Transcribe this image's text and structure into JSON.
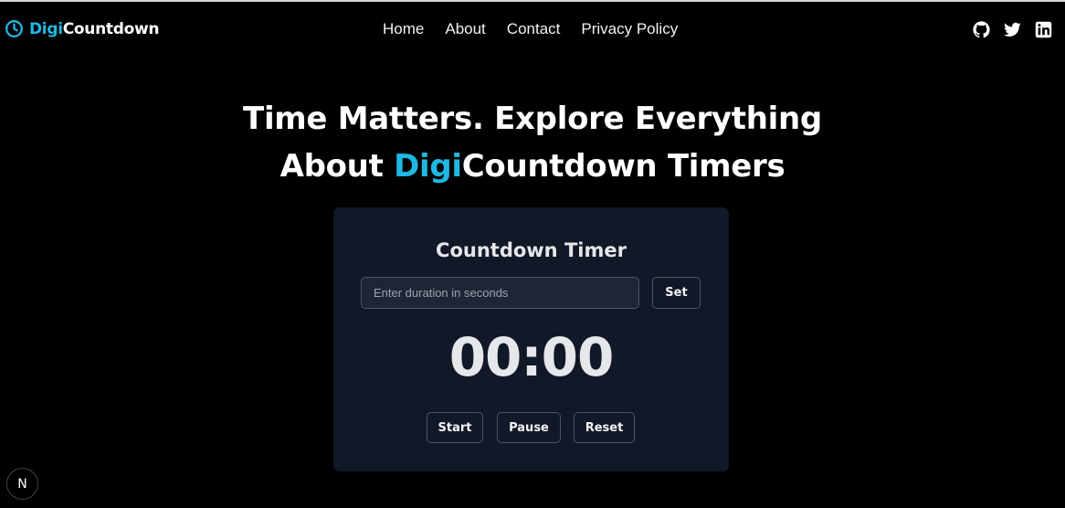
{
  "brand": {
    "prefix": "Digi",
    "suffix": "Countdown",
    "icon": "clock-icon",
    "accent_color": "#1fb8e3"
  },
  "nav": {
    "links": [
      {
        "label": "Home"
      },
      {
        "label": "About"
      },
      {
        "label": "Contact"
      },
      {
        "label": "Privacy Policy"
      }
    ],
    "socials": [
      {
        "icon": "github-icon"
      },
      {
        "icon": "twitter-icon"
      },
      {
        "icon": "linkedin-icon"
      }
    ]
  },
  "hero": {
    "line1": "Time Matters. Explore Everything",
    "line2_before": "About ",
    "line2_accent": "Digi",
    "line2_after": "Countdown Timers"
  },
  "timer_card": {
    "title": "Countdown Timer",
    "input_placeholder": "Enter duration in seconds",
    "input_value": "",
    "set_label": "Set",
    "display": "00:00",
    "start_label": "Start",
    "pause_label": "Pause",
    "reset_label": "Reset"
  },
  "dev_badge": {
    "label": "N"
  }
}
